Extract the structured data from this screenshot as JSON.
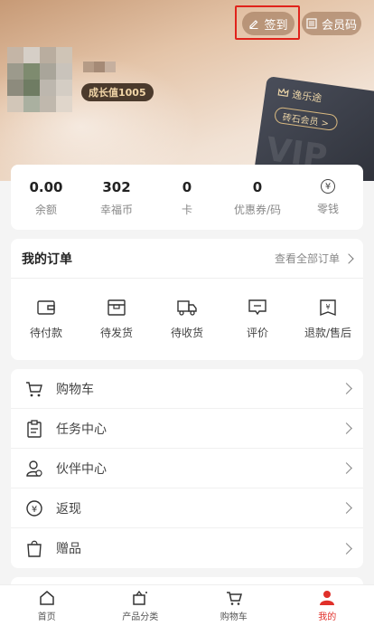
{
  "header": {
    "checkin_label": "签到",
    "member_code_label": "会员码",
    "growth_label": "成长值1005",
    "vip_brand": "逸乐途",
    "vip_level": "砖石会员 >",
    "vip_watermark": "VIP"
  },
  "stats": [
    {
      "value": "0.00",
      "label": "余额"
    },
    {
      "value": "302",
      "label": "幸福币"
    },
    {
      "value": "0",
      "label": "卡"
    },
    {
      "value": "0",
      "label": "优惠券/码"
    },
    {
      "value": "",
      "label": "零钱",
      "icon": "yen-circle-icon"
    }
  ],
  "orders": {
    "title": "我的订单",
    "view_all": "查看全部订单",
    "items": [
      {
        "label": "待付款",
        "icon": "wallet-icon"
      },
      {
        "label": "待发货",
        "icon": "box-icon"
      },
      {
        "label": "待收货",
        "icon": "truck-icon"
      },
      {
        "label": "评价",
        "icon": "comment-icon"
      },
      {
        "label": "退款/售后",
        "icon": "refund-icon"
      }
    ]
  },
  "menu": [
    {
      "label": "购物车",
      "icon": "cart-icon"
    },
    {
      "label": "任务中心",
      "icon": "clipboard-icon"
    },
    {
      "label": "伙伴中心",
      "icon": "partner-icon"
    },
    {
      "label": "返现",
      "icon": "cashback-icon"
    },
    {
      "label": "赠品",
      "icon": "gift-bag-icon"
    }
  ],
  "tabbar": [
    {
      "label": "首页",
      "icon": "home-icon",
      "active": false
    },
    {
      "label": "产品分类",
      "icon": "category-icon",
      "active": false
    },
    {
      "label": "购物车",
      "icon": "cart-icon",
      "active": false
    },
    {
      "label": "我的",
      "icon": "user-icon",
      "active": true
    }
  ],
  "colors": {
    "accent": "#e0302a",
    "highlight_box": "#e0231b",
    "growth_badge_bg": "#4b3a2c"
  }
}
